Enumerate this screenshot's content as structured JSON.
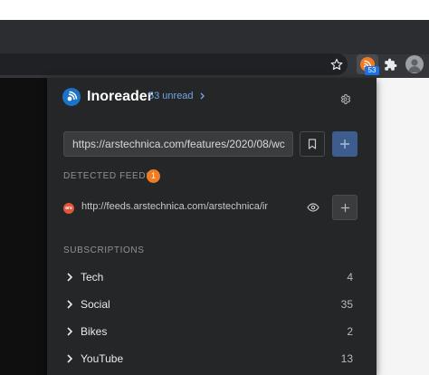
{
  "browser": {
    "extension_badge": "53",
    "star_icon": "star-icon",
    "extension_icon": "inoreader-extension-icon",
    "extensions_icon": "puzzle-icon",
    "profile_icon": "profile-icon"
  },
  "popup": {
    "brand": "Inoreader",
    "unread_link": "53 unread",
    "url_value": "https://arstechnica.com/features/2020/08/wc",
    "detected_heading": "DETECTED FEEDS",
    "detected_count": "1",
    "detected_feed": {
      "favicon_text": "ars",
      "url": "http://feeds.arstechnica.com/arstechnica/index"
    },
    "subscriptions_heading": "SUBSCRIPTIONS",
    "subscriptions": [
      {
        "name": "Tech",
        "count": "4"
      },
      {
        "name": "Social",
        "count": "35"
      },
      {
        "name": "Bikes",
        "count": "2"
      },
      {
        "name": "YouTube",
        "count": "13"
      }
    ]
  },
  "colors": {
    "accent_orange": "#f07b22",
    "accent_blue": "#3c5d8e",
    "link_blue": "#6fa6e6",
    "panel_bg": "#252627"
  }
}
